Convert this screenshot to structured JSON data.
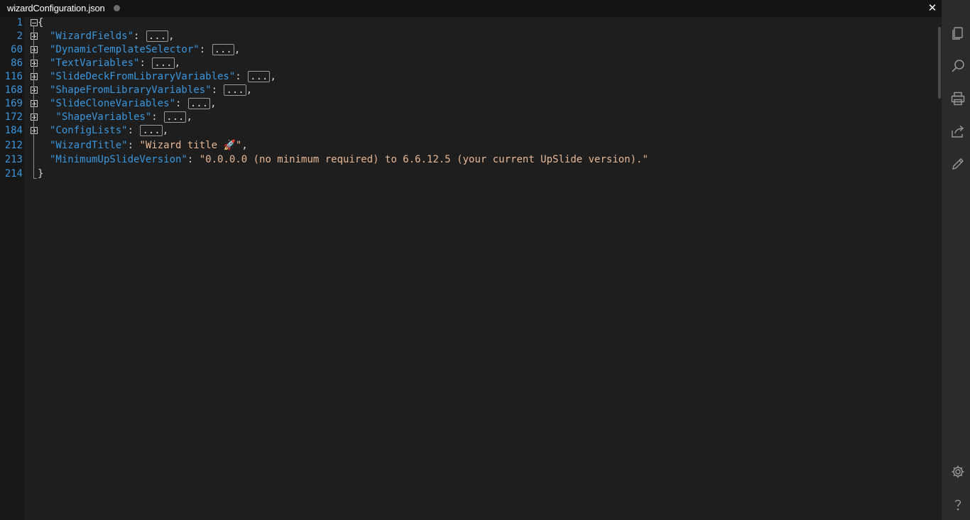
{
  "tab": {
    "title": "wizardConfiguration.json",
    "close_label": "✕"
  },
  "lines": [
    {
      "num": "1",
      "indent": 0,
      "text": "{"
    },
    {
      "num": "2",
      "key": "\"WizardFields\""
    },
    {
      "num": "60",
      "key": "\"DynamicTemplateSelector\""
    },
    {
      "num": "86",
      "key": "\"TextVariables\""
    },
    {
      "num": "116",
      "key": "\"SlideDeckFromLibraryVariables\""
    },
    {
      "num": "168",
      "key": "\"ShapeFromLibraryVariables\""
    },
    {
      "num": "169",
      "key": "\"SlideCloneVariables\""
    },
    {
      "num": "172",
      "key": " \"ShapeVariables\""
    },
    {
      "num": "184",
      "key": "\"ConfigLists\""
    },
    {
      "num": "212",
      "key": "\"WizardTitle\"",
      "value": "\"Wizard title 🚀\""
    },
    {
      "num": "213",
      "key": "\"MinimumUpSlideVersion\"",
      "value": "\"0.0.0.0 (no minimum required) to 6.6.12.5 (your current UpSlide version).\""
    },
    {
      "num": "214",
      "text": "}"
    }
  ],
  "collapsed_placeholder": "...",
  "sidebar_icons": [
    "copy-icon",
    "search-icon",
    "print-icon",
    "share-icon",
    "edit-icon",
    "settings-icon",
    "help-icon"
  ]
}
